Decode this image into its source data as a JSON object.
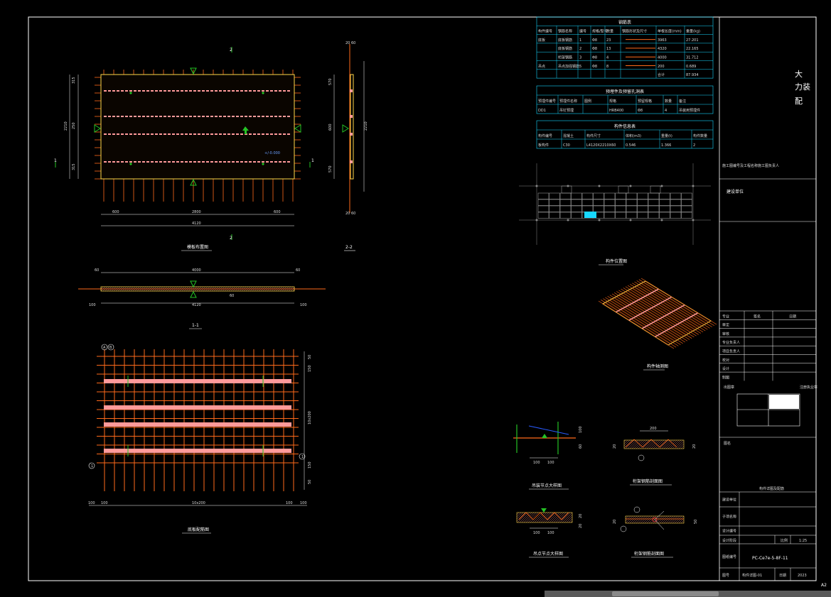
{
  "sheet": {
    "size_label": "A2",
    "colors": {
      "border": "#ffffff",
      "rebar": "#ff6a1a",
      "rebar_pink": "#ff9a9a",
      "green": "#25c225",
      "blue": "#2a5bff",
      "cyan": "#17d8ff",
      "yellow": "#ffd84a"
    }
  },
  "views": {
    "plan_title": "模板布置图",
    "section_22_title": "2-2",
    "section_11_title": "1-1",
    "rebar_plan_title": "底板配筋图",
    "location_title": "构件位置图",
    "iso_title": "构件轴测图",
    "detail1_title": "吊装节点大样图",
    "detail2_title": "桁架钢筋剖面图",
    "detail3_title": "吊点节点大样图",
    "detail4_title": "桁架钢筋剖面图",
    "marker_2": "2",
    "marker_1": "1",
    "elev_label": "+/-0.000",
    "axis_a": "A",
    "axis_b": "B",
    "axis_1": "1"
  },
  "plan_dims": {
    "left": [
      "315",
      "250",
      "315"
    ],
    "left_total": "2210",
    "bottom": [
      "600",
      "2800",
      "600"
    ],
    "bottom_total": "4120",
    "right_sec": [
      "20",
      "570",
      "600",
      "570",
      "20"
    ],
    "right_total": "2210",
    "sec_top": [
      "20",
      "60"
    ],
    "sec_bottom": [
      "20",
      "60"
    ],
    "sec11_top": "4000",
    "sec11_bottom": "4120",
    "sec11_mid": "60",
    "sec11_ends": [
      "60",
      "100",
      "100",
      "60"
    ]
  },
  "rebar_dims": {
    "right": [
      "50",
      "150",
      "10x200",
      "150",
      "50"
    ],
    "bottom": [
      "100",
      "10x200",
      "100"
    ],
    "bottom_ends": [
      "100",
      "100"
    ]
  },
  "detail_dims": {
    "d1": [
      "100",
      "100",
      "100",
      "60"
    ],
    "d2": [
      "200",
      "20",
      "20"
    ],
    "d3": [
      "100",
      "100",
      "20",
      "20"
    ],
    "d4": [
      "20",
      "50"
    ]
  },
  "tables": {
    "rebar_table": {
      "title": "钢筋表",
      "headers": [
        "构件编号",
        "钢筋名称",
        "编号",
        "规格/型号",
        "数量",
        "钢筋形状及尺寸",
        "单根长度(mm)",
        "重量(kg)"
      ],
      "rows": [
        [
          "底板",
          "底板钢筋",
          "1",
          "Φ8",
          "23",
          "",
          "3963",
          "27.201"
        ],
        [
          "",
          "底板钢筋",
          "2",
          "Φ8",
          "13",
          "",
          "4320",
          "22.165"
        ],
        [
          "",
          "桁架钢筋",
          "3",
          "Φ8",
          "4",
          "",
          "4000",
          "31.712"
        ],
        [
          "吊点",
          "吊点加强钢筋",
          "5",
          "Φ8",
          "8",
          "",
          "200",
          "0.689"
        ],
        [
          "",
          "",
          "",
          "",
          "",
          "",
          "合计",
          "87.934"
        ]
      ]
    },
    "embed_table": {
      "title": "预埋件及预留孔洞表",
      "headers": [
        "预埋件编号",
        "预埋件名称",
        "图例",
        "规格",
        "预留规格",
        "数量",
        "备注"
      ],
      "rows": [
        [
          "DD1",
          "吊钉预埋",
          "",
          "HRB400",
          "Φ8",
          "4",
          "吊装用预埋件"
        ]
      ]
    },
    "member_table": {
      "title": "构件信息表",
      "headers": [
        "构件编号",
        "混凝土",
        "构件尺寸",
        "体积(m3)",
        "重量(t)",
        "构件数量"
      ],
      "rows": [
        [
          "板构件",
          "C30",
          "L4120X2210X60",
          "0.546",
          "1.366",
          "2"
        ]
      ]
    }
  },
  "title_block": {
    "company_big": [
      "大",
      "力装",
      "配"
    ],
    "project_note": "施工图编号及工程名称施工图负责人",
    "project_label": "建设单位",
    "signs_header": [
      "专业",
      "签名",
      "日期"
    ],
    "signs": [
      "审定",
      "审核",
      "专业负责人",
      "项目负责人",
      "校对",
      "设计",
      "制图"
    ],
    "seal_label": "出图章",
    "seal_note": "注册执业章",
    "drawing_name_label": "图名",
    "drawing_name_note": "构件详图及配筋",
    "rows": [
      {
        "label": "建设单位",
        "value": ""
      },
      {
        "label": "子项名称",
        "value": ""
      },
      {
        "label": "设计编号",
        "value": ""
      }
    ],
    "scale_label": "比例",
    "scale_value": "1:25",
    "drawing_no_label": "图纸编号",
    "drawing_no": "PC-Ce7e-5-8F-11",
    "sheet_label": "图号",
    "sheet_value": "构件详图-01",
    "date_label": "日期",
    "date_value": "2023",
    "stage_label": "设计阶段"
  }
}
